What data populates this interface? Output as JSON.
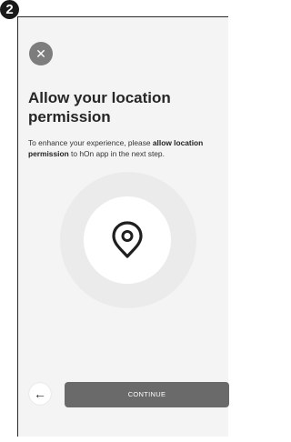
{
  "step": {
    "number": "2"
  },
  "close": {
    "icon": "close-icon",
    "glyph": "✕"
  },
  "content": {
    "title": "Allow your location permission",
    "description_pre": "To enhance your experience, please ",
    "description_bold": "allow location permission",
    "description_post": " to hOn app in the next step."
  },
  "illustration": {
    "icon": "location-pin-icon"
  },
  "footer": {
    "back_icon": "arrow-left-icon",
    "back_glyph": "←",
    "continue_label": "CONTINUE"
  },
  "colors": {
    "screen_background": "#f4f4f4",
    "close_button": "#7d7d7d",
    "continue_button": "#6a6a6a",
    "ring": "#ebebeb",
    "text": "#262626"
  }
}
